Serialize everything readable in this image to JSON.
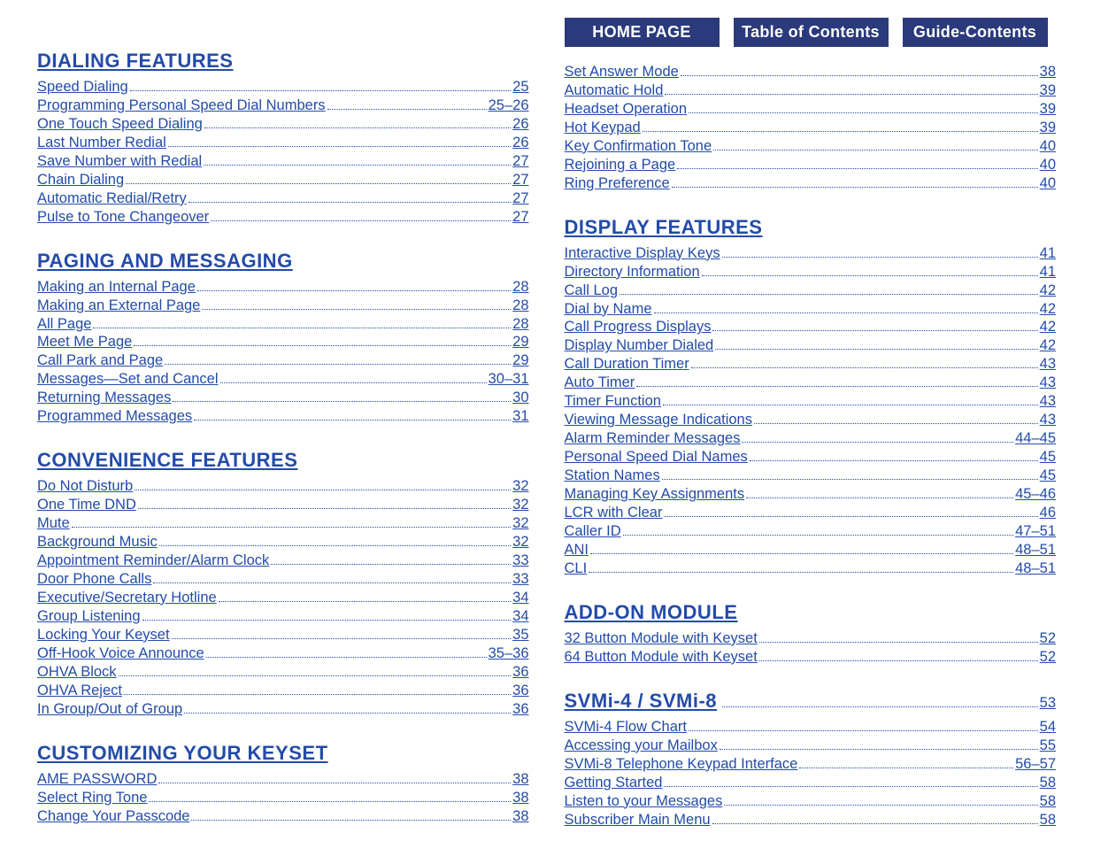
{
  "nav": {
    "home": "HOME PAGE",
    "toc": "Table of Contents",
    "guide": "Guide-Contents"
  },
  "left": [
    {
      "title": "DIALING FEATURES",
      "items": [
        {
          "label": "Speed Dialing",
          "page": "25"
        },
        {
          "label": "Programming Personal Speed Dial Numbers",
          "page": "25–26"
        },
        {
          "label": "One Touch Speed Dialing",
          "page": "26"
        },
        {
          "label": "Last Number Redial",
          "page": "26"
        },
        {
          "label": "Save Number with Redial",
          "page": "27"
        },
        {
          "label": "Chain Dialing",
          "page": "27"
        },
        {
          "label": "Automatic Redial/Retry",
          "page": "27"
        },
        {
          "label": "Pulse to Tone Changeover",
          "page": "27"
        }
      ]
    },
    {
      "title": "PAGING AND MESSAGING",
      "items": [
        {
          "label": "Making an Internal Page",
          "page": "28"
        },
        {
          "label": "Making an External Page",
          "page": "28"
        },
        {
          "label": "All Page",
          "page": "28"
        },
        {
          "label": "Meet Me Page",
          "page": "29"
        },
        {
          "label": "Call Park and Page",
          "page": "29"
        },
        {
          "label": "Messages—Set and Cancel",
          "page": "30–31"
        },
        {
          "label": "Returning Messages",
          "page": "30"
        },
        {
          "label": "Programmed Messages",
          "page": "31"
        }
      ]
    },
    {
      "title": "CONVENIENCE FEATURES",
      "items": [
        {
          "label": "Do Not Disturb",
          "page": "32"
        },
        {
          "label": "One Time DND",
          "page": "32"
        },
        {
          "label": "Mute",
          "page": "32"
        },
        {
          "label": "Background Music",
          "page": "32"
        },
        {
          "label": "Appointment Reminder/Alarm Clock",
          "page": "33"
        },
        {
          "label": "Door Phone Calls",
          "page": "33"
        },
        {
          "label": "Executive/Secretary Hotline",
          "page": "34"
        },
        {
          "label": "Group Listening",
          "page": "34"
        },
        {
          "label": "Locking Your Keyset",
          "page": "35"
        },
        {
          "label": "Off-Hook Voice Announce",
          "page": "35–36"
        },
        {
          "label": "OHVA Block",
          "page": "36"
        },
        {
          "label": "OHVA Reject",
          "page": "36"
        },
        {
          "label": "In Group/Out of Group",
          "page": "36"
        }
      ]
    },
    {
      "title": "CUSTOMIZING YOUR KEYSET",
      "items": [
        {
          "label": "AME PASSWORD",
          "page": "38"
        },
        {
          "label": "Select Ring Tone",
          "page": "38"
        },
        {
          "label": "Change Your Passcode",
          "page": "38"
        }
      ]
    }
  ],
  "right_loose": [
    {
      "label": "Set Answer Mode",
      "page": "38"
    },
    {
      "label": "Automatic Hold",
      "page": "39"
    },
    {
      "label": "Headset Operation",
      "page": "39"
    },
    {
      "label": "Hot Keypad",
      "page": "39"
    },
    {
      "label": "Key Confirmation Tone",
      "page": "40"
    },
    {
      "label": "Rejoining a Page",
      "page": "40"
    },
    {
      "label": "Ring Preference",
      "page": "40"
    }
  ],
  "right": [
    {
      "title": "DISPLAY FEATURES",
      "items": [
        {
          "label": "Interactive Display Keys",
          "page": "41"
        },
        {
          "label": "Directory Information",
          "page": " 41"
        },
        {
          "label": "Call Log",
          "page": "42"
        },
        {
          "label": "Dial by Name",
          "page": "42"
        },
        {
          "label": "Call Progress Displays",
          "page": "42"
        },
        {
          "label": "Display Number Dialed",
          "page": "42"
        },
        {
          "label": "Call Duration Timer",
          "page": "43"
        },
        {
          "label": "Auto Timer",
          "page": "43"
        },
        {
          "label": "Timer Function",
          "page": "43"
        },
        {
          "label": "Viewing Message Indications",
          "page": "43"
        },
        {
          "label": "Alarm Reminder Messages",
          "page": "44–45"
        },
        {
          "label": "Personal Speed Dial Names",
          "page": "45"
        },
        {
          "label": "Station Names",
          "page": "45"
        },
        {
          "label": "Managing Key Assignments",
          "page": "45–46"
        },
        {
          "label": "LCR with Clear",
          "page": "46"
        },
        {
          "label": "Caller ID",
          "page": "47–51"
        },
        {
          "label": "ANI",
          "page": "48–51"
        },
        {
          "label": "CLI",
          "page": "48–51"
        }
      ]
    },
    {
      "title": "ADD-ON MODULE",
      "items": [
        {
          "label": "32 Button Module with Keyset",
          "page": "52"
        },
        {
          "label": "64 Button Module with Keyset",
          "page": " 52"
        }
      ]
    }
  ],
  "svmi": {
    "title": "SVMi-4 / SVMi-8",
    "page": "53",
    "items": [
      {
        "label": "SVMi-4 Flow Chart",
        "page": "54"
      },
      {
        "label": "Accessing your Mailbox",
        "page": "55"
      },
      {
        "label": "SVMi-8 Telephone Keypad Interface",
        "page": "56–57"
      },
      {
        "label": "Getting Started",
        "page": "58"
      },
      {
        "label": "Listen to your Messages",
        "page": "58"
      },
      {
        "label": "Subscriber Main Menu",
        "page": "58"
      }
    ]
  }
}
